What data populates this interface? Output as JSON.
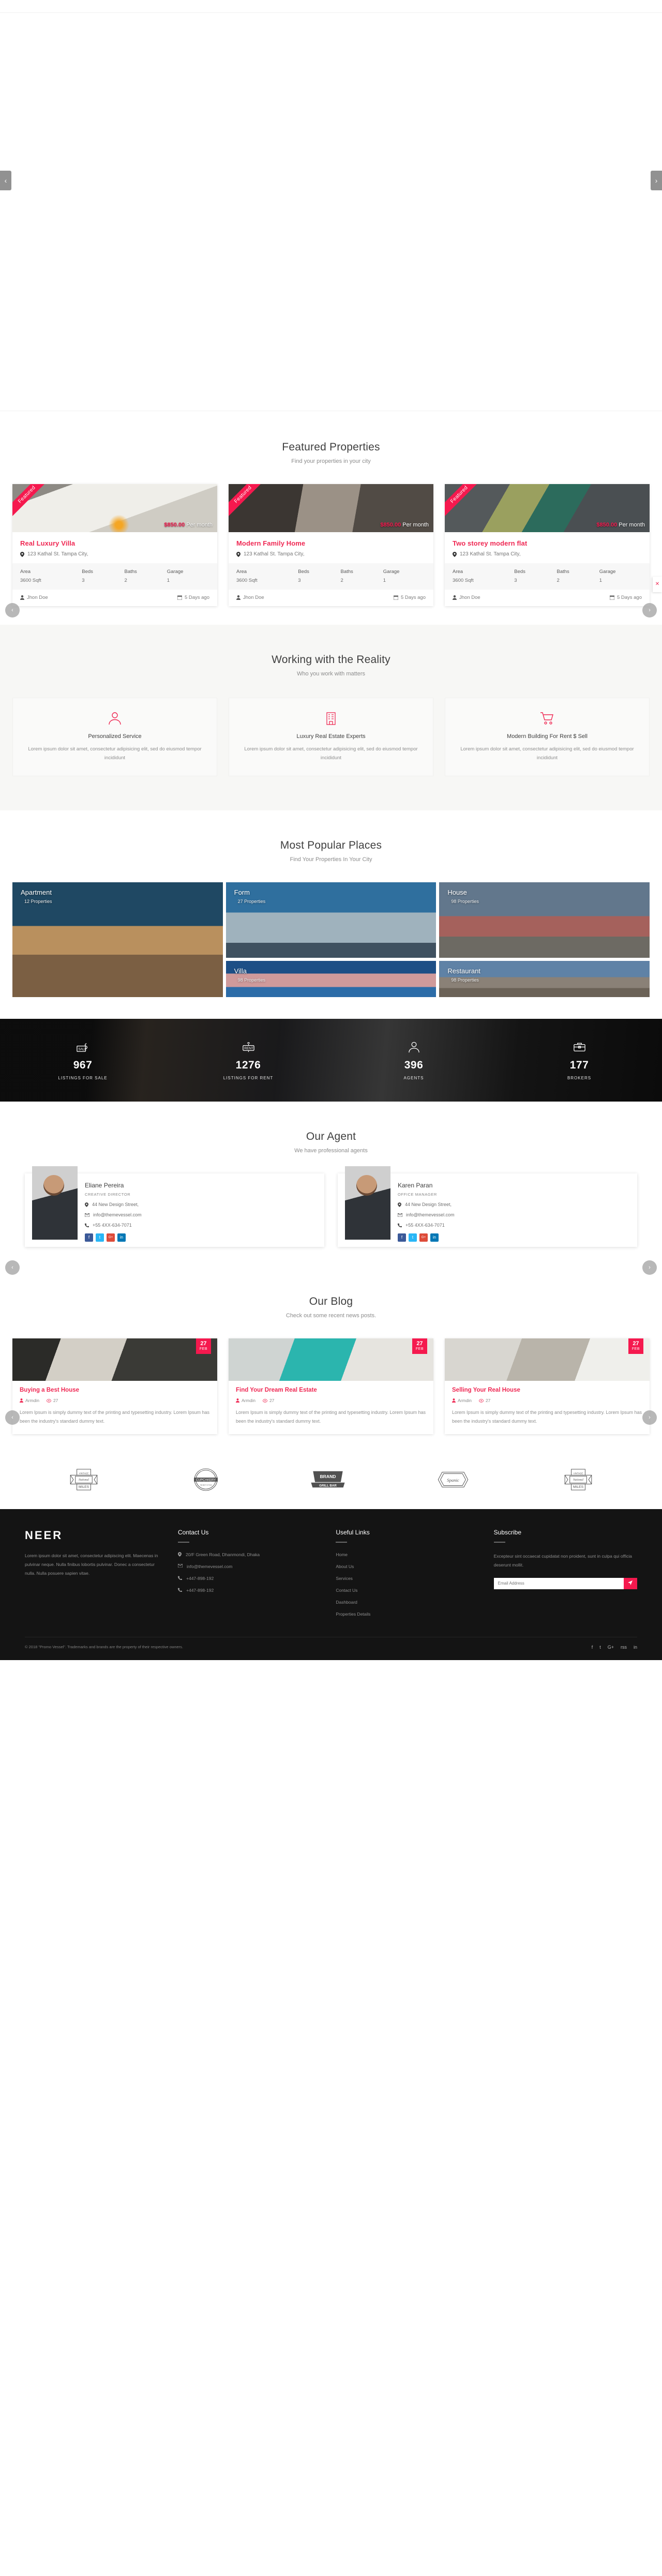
{
  "hero": {
    "prev_label": "‹",
    "next_label": "›"
  },
  "featured": {
    "title": "Featured Properties",
    "subtitle": "Find your properties in your city",
    "prev_label": "‹",
    "next_label": "›",
    "close_label": "✕",
    "spec_headers": [
      "Area",
      "Beds",
      "Baths",
      "Garage"
    ],
    "items": [
      {
        "ribbon": "Featured",
        "price": "$850.00",
        "price_unit": "Per month",
        "title": "Real Luxury Villa",
        "address": "123 Kathal St. Tampa City,",
        "area": "3600 Sqft",
        "beds": "3",
        "baths": "2",
        "garage": "1",
        "author": "Jhon Doe",
        "date": "5 Days ago"
      },
      {
        "ribbon": "Featured",
        "price": "$850.00",
        "price_unit": "Per month",
        "title": "Modern Family Home",
        "address": "123 Kathal St. Tampa City,",
        "area": "3600 Sqft",
        "beds": "3",
        "baths": "2",
        "garage": "1",
        "author": "Jhon Doe",
        "date": "5 Days ago"
      },
      {
        "ribbon": "Featured",
        "price": "$850.00",
        "price_unit": "Per month",
        "title": "Two storey modern flat",
        "address": "123 Kathal St. Tampa City,",
        "area": "3600 Sqft",
        "beds": "3",
        "baths": "2",
        "garage": "1",
        "author": "Jhon Doe",
        "date": "5 Days ago"
      }
    ]
  },
  "services": {
    "title": "Working with the Reality",
    "subtitle": "Who you work with matters",
    "items": [
      {
        "icon": "user-icon",
        "title": "Personalized Service",
        "text": "Lorem ipsum dolor sit amet, consectetur adipisicing elit, sed do eiusmod tempor incididunt"
      },
      {
        "icon": "building-icon",
        "title": "Luxury Real Estate Experts",
        "text": "Lorem ipsum dolor sit amet, consectetur adipisicing elit, sed do eiusmod tempor incididunt"
      },
      {
        "icon": "cart-icon",
        "title": "Modern Building For Rent $ Sell",
        "text": "Lorem ipsum dolor sit amet, consectetur adipisicing elit, sed do eiusmod tempor incididunt"
      }
    ]
  },
  "popular": {
    "title": "Most Popular Places",
    "subtitle": "Find Your Properties In Your City",
    "places": [
      {
        "name": "Apartment",
        "count": "12 Properties"
      },
      {
        "name": "Form",
        "count": "27 Properties"
      },
      {
        "name": "House",
        "count": "98 Properties"
      },
      {
        "name": "Villa",
        "count": "98 Properties"
      },
      {
        "name": "Restaurant",
        "count": "98 Properties"
      }
    ]
  },
  "stats": [
    {
      "icon": "sale-tag-icon",
      "value": "967",
      "label": "LISTINGS FOR SALE"
    },
    {
      "icon": "rent-sign-icon",
      "value": "1276",
      "label": "LISTINGS FOR RENT"
    },
    {
      "icon": "agent-icon",
      "value": "396",
      "label": "AGENTS"
    },
    {
      "icon": "broker-icon",
      "value": "177",
      "label": "BROKERS"
    }
  ],
  "agents": {
    "title": "Our Agent",
    "subtitle": "We have professional agents",
    "prev_label": "‹",
    "next_label": "›",
    "items": [
      {
        "name": "Eliane Pereira",
        "role": "CREATIVE DIRECTOR",
        "address": "44 New Design Street,",
        "email": "info@themevessel.com",
        "phone": "+55 4XX-634-7071",
        "socials": [
          "f",
          "t",
          "G+",
          "in"
        ]
      },
      {
        "name": "Karen Paran",
        "role": "OFFICE MANAGER",
        "address": "44 New Design Street,",
        "email": "info@themevessel.com",
        "phone": "+55 4XX-634-7071",
        "socials": [
          "f",
          "t",
          "G+",
          "in"
        ]
      }
    ]
  },
  "blog": {
    "title": "Our Blog",
    "subtitle": "Check out some recent news posts.",
    "items": [
      {
        "day": "27",
        "month": "FEB",
        "title": "Buying a Best House",
        "author": "Armdin",
        "views": "27",
        "text": "Lorem Ipsum is simply dummy text of the printing and typesetting industry. Lorem Ipsum has been the industry's standard dummy text."
      },
      {
        "day": "27",
        "month": "FEB",
        "title": "Find Your Dream Real Estate",
        "author": "Armdin",
        "views": "27",
        "text": "Lorem Ipsum is simply dummy text of the printing and typesetting industry. Lorem Ipsum has been the industry's standard dummy text."
      },
      {
        "day": "27",
        "month": "FEB",
        "title": "Selling Your Real House",
        "author": "Armdin",
        "views": "27",
        "text": "Lorem Ipsum is simply dummy text of the printing and typesetting industry. Lorem Ipsum has been the industry's standard dummy text."
      }
    ]
  },
  "brands": [
    {
      "name": "vintage-national-miles-logo",
      "line1": "VINTAGE",
      "line2": "National",
      "line3": "MILES"
    },
    {
      "name": "cupcakery-logo",
      "line1": "CUPCAKERY",
      "line2": "THE BEST IN TOWN",
      "line3": ""
    },
    {
      "name": "brand-grill-bar-logo",
      "line1": "BRAND",
      "line2": "GRILL BAR",
      "line3": ""
    },
    {
      "name": "spanic-logo",
      "line1": "Spanic",
      "line2": "",
      "line3": ""
    },
    {
      "name": "vintage-national-miles-logo-2",
      "line1": "VINTAGE",
      "line2": "National",
      "line3": "MILES"
    }
  ],
  "footer": {
    "logo": "NEER",
    "about": "Lorem ipsum dolor sit amet, consectetur adipiscing elit. Maecenas in pulvinar neque. Nulla finibus lobortis pulvinar. Donec a consectetur nulla. Nulla posuere sapien vitae.",
    "contact": {
      "title": "Contact Us",
      "address": "20/F Green Road, Dhanmondi, Dhaka",
      "email": "info@themevessel.com",
      "phone1": "+447-898-192",
      "phone2": "+447-898-192"
    },
    "useful": {
      "title": "Useful Links",
      "links": [
        "Home",
        "About Us",
        "Services",
        "Contact Us",
        "Dashboard",
        "Properties Details"
      ]
    },
    "subscribe": {
      "title": "Subscribe",
      "text": "Excepteur sint occaecat cupidatat non proident, sunt in culpa qui officia deserunt mollit.",
      "placeholder": "Email Address",
      "button_icon": "send-icon"
    },
    "copyright": "© 2018 \"Promo Vessel\". Trademarks and brands are the property of their respective owners.",
    "socials": [
      "f",
      "t",
      "G+",
      "rss",
      "in"
    ]
  },
  "colors": {
    "accent": "#ef2853",
    "accent_bright": "#f5194e",
    "dark": "#141414",
    "muted": "#8e8e8e"
  }
}
